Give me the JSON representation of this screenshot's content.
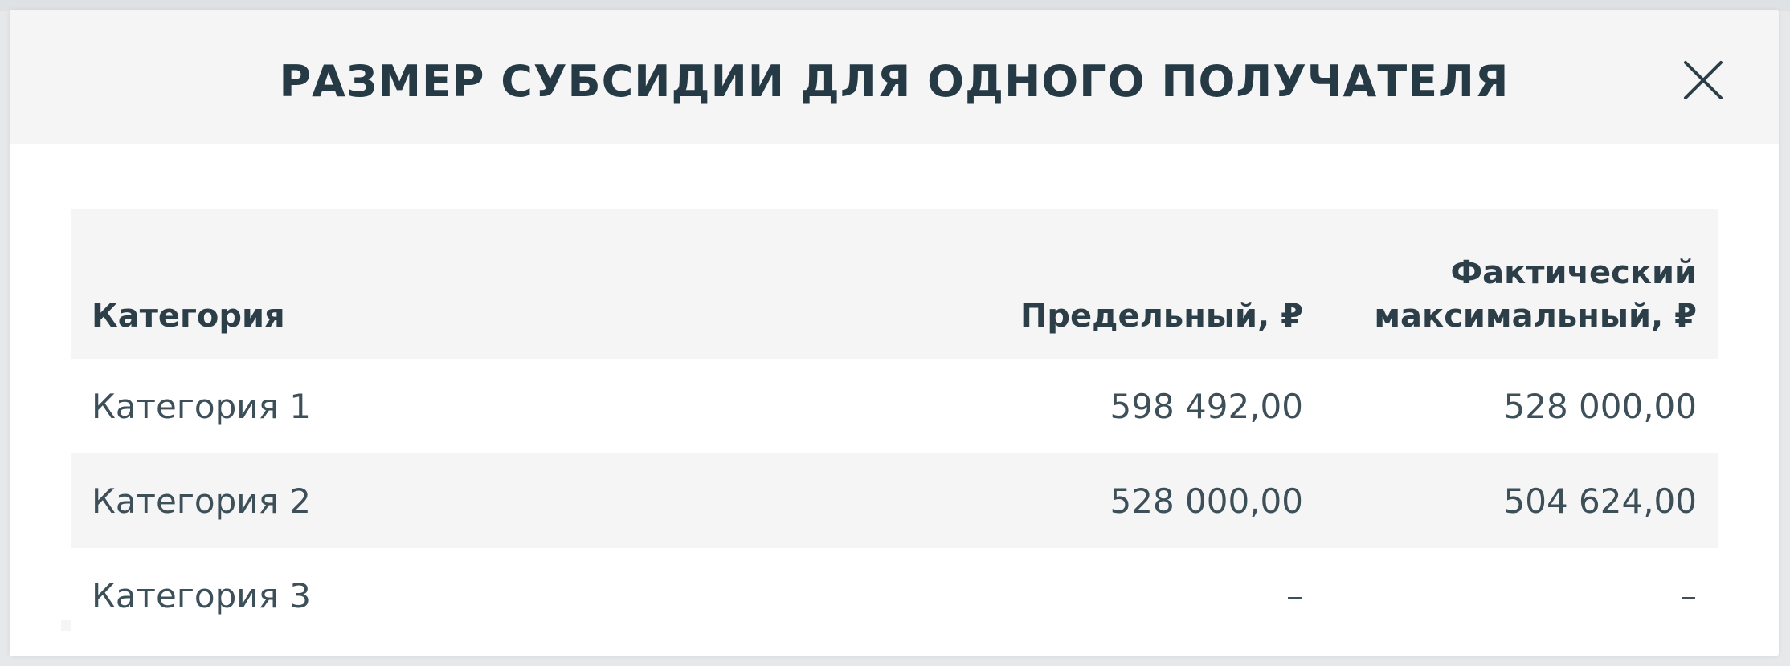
{
  "modal": {
    "title": "РАЗМЕР СУБСИДИИ ДЛЯ ОДНОГО ПОЛУЧАТЕЛЯ",
    "close_icon": "close-icon"
  },
  "table": {
    "headers": {
      "category": "Категория",
      "limit": "Предельный, ₽",
      "actual_line1": "Фактический",
      "actual_line2": "максимальный, ₽"
    },
    "rows": [
      {
        "category": "Категория 1",
        "limit": "598 492,00",
        "actual": "528 000,00"
      },
      {
        "category": "Категория 2",
        "limit": "528 000,00",
        "actual": "504 624,00"
      },
      {
        "category": "Категория 3",
        "limit": "–",
        "actual": "–"
      }
    ]
  },
  "colors": {
    "header_bg": "#f5f5f5",
    "text": "#2c3e47",
    "backdrop": "#e6e8ea"
  }
}
